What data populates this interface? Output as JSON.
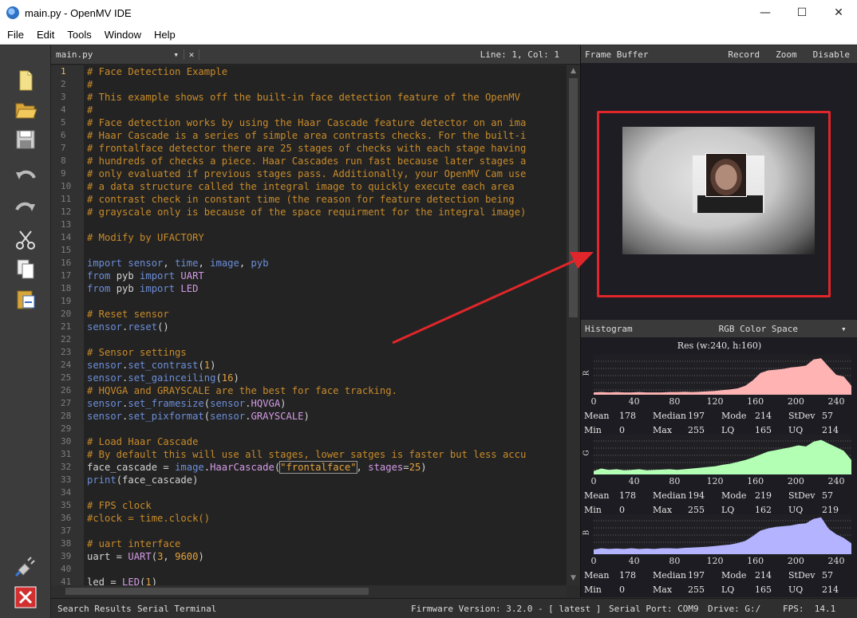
{
  "window": {
    "title": "main.py - OpenMV IDE",
    "min": "—",
    "max": "☐",
    "close": "✕"
  },
  "menu": [
    "File",
    "Edit",
    "Tools",
    "Window",
    "Help"
  ],
  "toolbar": [
    "new-file",
    "open-file",
    "save",
    "undo",
    "redo",
    "cut",
    "copy",
    "paste",
    "connect",
    "disconnect"
  ],
  "editor": {
    "file": "main.py",
    "combo_arrow": "▾",
    "close": "✕",
    "position": "Line: 1, Col: 1",
    "current_line": 1,
    "lines": [
      [
        [
          "c",
          "# Face Detection Example"
        ]
      ],
      [
        [
          "c",
          "#"
        ]
      ],
      [
        [
          "c",
          "# This example shows off the built-in face detection feature of the OpenMV"
        ]
      ],
      [
        [
          "c",
          "#"
        ]
      ],
      [
        [
          "c",
          "# Face detection works by using the Haar Cascade feature detector on an ima"
        ]
      ],
      [
        [
          "c",
          "# Haar Cascade is a series of simple area contrasts checks. For the built-i"
        ]
      ],
      [
        [
          "c",
          "# frontalface detector there are 25 stages of checks with each stage having"
        ]
      ],
      [
        [
          "c",
          "# hundreds of checks a piece. Haar Cascades run fast because later stages a"
        ]
      ],
      [
        [
          "c",
          "# only evaluated if previous stages pass. Additionally, your OpenMV Cam use"
        ]
      ],
      [
        [
          "c",
          "# a data structure called the integral image to quickly execute each area"
        ]
      ],
      [
        [
          "c",
          "# contrast check in constant time (the reason for feature detection being"
        ]
      ],
      [
        [
          "c",
          "# grayscale only is because of the space requirment for the integral image)"
        ]
      ],
      [],
      [
        [
          "c",
          "# Modify by UFACTORY"
        ]
      ],
      [],
      [
        [
          "k",
          "import"
        ],
        [
          "t",
          " "
        ],
        [
          "k",
          "sensor"
        ],
        [
          "t",
          ", "
        ],
        [
          "k",
          "time"
        ],
        [
          "t",
          ", "
        ],
        [
          "k",
          "image"
        ],
        [
          "t",
          ", "
        ],
        [
          "k",
          "pyb"
        ]
      ],
      [
        [
          "k",
          "from"
        ],
        [
          "t",
          " pyb "
        ],
        [
          "k",
          "import"
        ],
        [
          "t",
          " "
        ],
        [
          "f",
          "UART"
        ]
      ],
      [
        [
          "k",
          "from"
        ],
        [
          "t",
          " pyb "
        ],
        [
          "k",
          "import"
        ],
        [
          "t",
          " "
        ],
        [
          "f",
          "LED"
        ]
      ],
      [],
      [
        [
          "c",
          "# Reset sensor"
        ]
      ],
      [
        [
          "k",
          "sensor"
        ],
        [
          "t",
          "."
        ],
        [
          "k",
          "reset"
        ],
        [
          "t",
          "()"
        ]
      ],
      [],
      [
        [
          "c",
          "# Sensor settings"
        ]
      ],
      [
        [
          "k",
          "sensor"
        ],
        [
          "t",
          "."
        ],
        [
          "k",
          "set_contrast"
        ],
        [
          "t",
          "("
        ],
        [
          "n",
          "1"
        ],
        [
          "t",
          ")"
        ]
      ],
      [
        [
          "k",
          "sensor"
        ],
        [
          "t",
          "."
        ],
        [
          "k",
          "set_gainceiling"
        ],
        [
          "t",
          "("
        ],
        [
          "n",
          "16"
        ],
        [
          "t",
          ")"
        ]
      ],
      [
        [
          "c",
          "# HQVGA and GRAYSCALE are the best for face tracking."
        ]
      ],
      [
        [
          "k",
          "sensor"
        ],
        [
          "t",
          "."
        ],
        [
          "k",
          "set_framesize"
        ],
        [
          "t",
          "("
        ],
        [
          "k",
          "sensor"
        ],
        [
          "t",
          "."
        ],
        [
          "f",
          "HQVGA"
        ],
        [
          "t",
          ")"
        ]
      ],
      [
        [
          "k",
          "sensor"
        ],
        [
          "t",
          "."
        ],
        [
          "k",
          "set_pixformat"
        ],
        [
          "t",
          "("
        ],
        [
          "k",
          "sensor"
        ],
        [
          "t",
          "."
        ],
        [
          "f",
          "GRAYSCALE"
        ],
        [
          "t",
          ")"
        ]
      ],
      [],
      [
        [
          "c",
          "# Load Haar Cascade"
        ]
      ],
      [
        [
          "c",
          "# By default this will use all stages, lower satges is faster but less accu"
        ]
      ],
      [
        [
          "t",
          "face_cascade = "
        ],
        [
          "k",
          "image"
        ],
        [
          "t",
          "."
        ],
        [
          "f",
          "HaarCascade"
        ],
        [
          "t",
          "("
        ],
        [
          "s",
          "\"frontalface\""
        ],
        [
          "t",
          ", "
        ],
        [
          "f",
          "stages"
        ],
        [
          "t",
          "="
        ],
        [
          "n",
          "25"
        ],
        [
          "t",
          ")"
        ]
      ],
      [
        [
          "k",
          "print"
        ],
        [
          "t",
          "(face_cascade)"
        ]
      ],
      [],
      [
        [
          "c",
          "# FPS clock"
        ]
      ],
      [
        [
          "c",
          "#clock = time.clock()"
        ]
      ],
      [],
      [
        [
          "c",
          "# uart interface"
        ]
      ],
      [
        [
          "t",
          "uart = "
        ],
        [
          "f",
          "UART"
        ],
        [
          "t",
          "("
        ],
        [
          "n",
          "3"
        ],
        [
          "t",
          ", "
        ],
        [
          "n",
          "9600"
        ],
        [
          "t",
          ")"
        ]
      ],
      [],
      [
        [
          "t",
          "led = "
        ],
        [
          "f",
          "LED"
        ],
        [
          "t",
          "("
        ],
        [
          "n",
          "1"
        ],
        [
          "t",
          ")"
        ]
      ]
    ]
  },
  "framebuffer": {
    "label": "Frame Buffer",
    "actions": [
      "Record",
      "Zoom",
      "Disable"
    ]
  },
  "histogram": {
    "label": "Histogram",
    "color_space": "RGB Color Space",
    "dropdown_arrow": "▾",
    "resolution": "Res (w:240, h:160)",
    "ticks": [
      "0",
      "40",
      "80",
      "120",
      "160",
      "200",
      "240"
    ],
    "stat_labels": [
      "Mean",
      "Median",
      "Mode",
      "StDev",
      "Min",
      "Max",
      "LQ",
      "UQ"
    ],
    "channels": [
      {
        "name": "R",
        "color": "#ffb3b3",
        "mean": "178",
        "median": "197",
        "mode": "214",
        "stdev": "57",
        "min": "0",
        "max": "255",
        "lq": "165",
        "uq": "214",
        "profile": [
          0.02,
          0.03,
          0.02,
          0.03,
          0.02,
          0.02,
          0.03,
          0.02,
          0.02,
          0.02,
          0.03,
          0.03,
          0.04,
          0.03,
          0.04,
          0.05,
          0.06,
          0.08,
          0.1,
          0.13,
          0.2,
          0.35,
          0.55,
          0.62,
          0.64,
          0.66,
          0.7,
          0.72,
          0.75,
          0.92,
          0.95,
          0.72,
          0.5,
          0.45,
          0.2
        ]
      },
      {
        "name": "G",
        "color": "#b3ffb3",
        "mean": "178",
        "median": "194",
        "mode": "219",
        "stdev": "57",
        "min": "0",
        "max": "255",
        "lq": "162",
        "uq": "219",
        "profile": [
          0.05,
          0.12,
          0.08,
          0.1,
          0.07,
          0.08,
          0.1,
          0.07,
          0.08,
          0.09,
          0.1,
          0.08,
          0.1,
          0.12,
          0.14,
          0.16,
          0.18,
          0.22,
          0.25,
          0.3,
          0.35,
          0.42,
          0.5,
          0.58,
          0.62,
          0.66,
          0.7,
          0.75,
          0.72,
          0.85,
          0.9,
          0.8,
          0.7,
          0.6,
          0.35
        ]
      },
      {
        "name": "B",
        "color": "#b3b3ff",
        "mean": "178",
        "median": "197",
        "mode": "214",
        "stdev": "57",
        "min": "0",
        "max": "255",
        "lq": "165",
        "uq": "214",
        "profile": [
          0.08,
          0.12,
          0.1,
          0.11,
          0.1,
          0.12,
          0.1,
          0.11,
          0.1,
          0.12,
          0.12,
          0.11,
          0.13,
          0.14,
          0.15,
          0.16,
          0.18,
          0.2,
          0.22,
          0.26,
          0.32,
          0.45,
          0.6,
          0.66,
          0.7,
          0.72,
          0.74,
          0.78,
          0.8,
          0.92,
          0.96,
          0.65,
          0.5,
          0.4,
          0.25
        ]
      }
    ]
  },
  "statusbar": {
    "search": "Search Results",
    "serial": "Serial Terminal",
    "firmware": "Firmware Version: 3.2.0 - [ latest ]",
    "port": "Serial Port: COM9",
    "drive": "Drive: G:/",
    "fps": "FPS:  14.1"
  },
  "colors": {
    "accent_red": "#e0262a",
    "comment": "#c88b2a",
    "keyword": "#6c8ed8"
  }
}
